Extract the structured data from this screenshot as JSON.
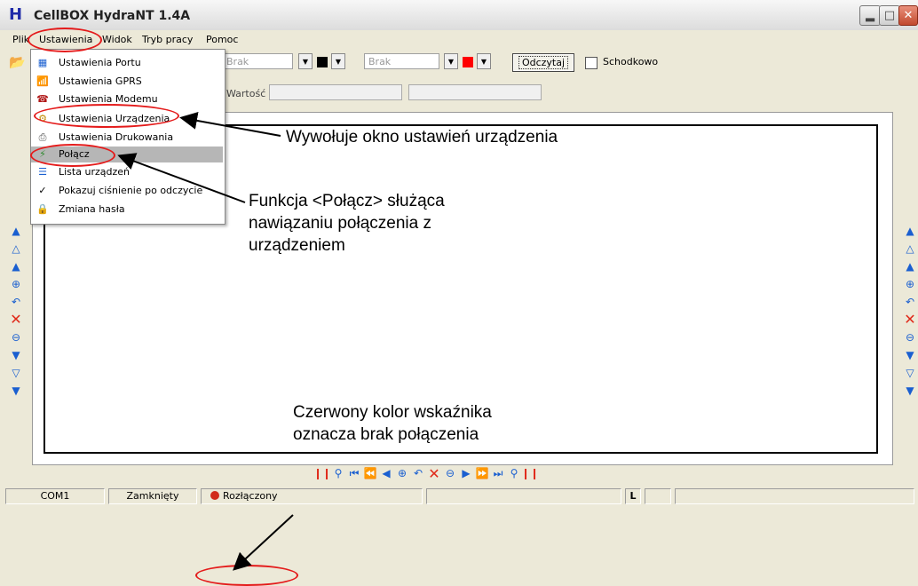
{
  "window": {
    "title": "CellBOX HydraNT 1.4A",
    "app_icon": "H",
    "minimize_icon": "minimize-icon",
    "maximize_icon": "maximize-icon",
    "close_icon": "close-icon"
  },
  "menubar": {
    "items": [
      "Plik",
      "Ustawienia",
      "Widok",
      "Tryb pracy",
      "Pomoc"
    ]
  },
  "toolbar": {
    "combo1_value": "Brak",
    "combo2_value": "Brak",
    "color1": "#000000",
    "color2": "#ff0000",
    "read_button": "Odczytaj",
    "stepped_label": "Schodkowo",
    "stepped_checked": false
  },
  "value_row": {
    "label": "Wartość",
    "value1": "",
    "value2": ""
  },
  "settings_menu": {
    "items": [
      {
        "label": "Ustawienia Portu",
        "icon": "port-icon"
      },
      {
        "label": "Ustawienia GPRS",
        "icon": "gprs-icon"
      },
      {
        "label": "Ustawienia Modemu",
        "icon": "phone-icon"
      },
      {
        "label": "Ustawienia Urządzenia",
        "icon": "device-icon"
      },
      {
        "label": "Ustawienia Drukowania",
        "icon": "printer-icon"
      },
      {
        "label": "Połącz",
        "icon": "connect-icon",
        "selected": true
      },
      {
        "label": "Lista urządzeń",
        "icon": "list-icon"
      },
      {
        "label": "Pokazuj ciśnienie po odczycie",
        "icon": "checkmark-icon",
        "checked": true
      },
      {
        "label": "Zmiana hasła",
        "icon": "lock-icon"
      }
    ]
  },
  "side_toolbar": {
    "buttons": [
      "scroll-top-icon",
      "page-up-icon",
      "step-up-icon",
      "zoom-in-icon",
      "undo-zoom-icon",
      "delete-icon",
      "zoom-out-icon",
      "step-down-icon",
      "page-down-icon",
      "scroll-bottom-icon"
    ]
  },
  "bottom_toolbar": {
    "buttons": [
      "marker-left-icon",
      "zoom-fit-icon",
      "first-icon",
      "fast-back-icon",
      "back-icon",
      "zoom-in-icon",
      "undo-zoom-icon",
      "delete-icon",
      "zoom-out-icon",
      "forward-icon",
      "fast-forward-icon",
      "last-icon",
      "zoom-reset-icon",
      "marker-right-icon"
    ]
  },
  "statusbar": {
    "port": "COM1",
    "state": "Zamknięty",
    "connection": "Rozłączony",
    "connection_color": "#d12b1b",
    "indicator": "L"
  },
  "annotations": {
    "device_settings": "Wywołuje okno ustawień urządzenia",
    "connect_function": [
      "Funkcja <Połącz> służąca",
      "nawiązaniu połączenia z",
      "urządzeniem"
    ],
    "red_indicator": [
      "Czerwony kolor wskaźnika",
      "oznacza brak połączenia"
    ],
    "highlight_color": "#e41b1b"
  }
}
